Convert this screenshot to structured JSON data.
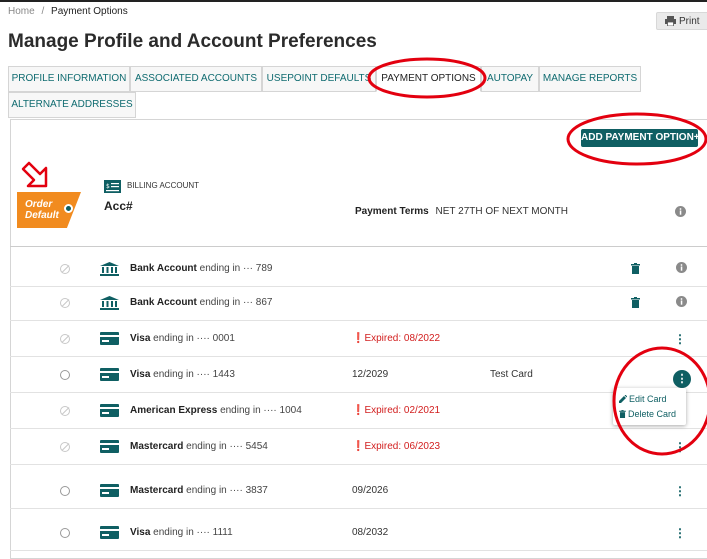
{
  "breadcrumb": {
    "home": "Home",
    "separator": "/",
    "current": "Payment Options"
  },
  "print_label": "Print",
  "title": "Manage Profile and Account Preferences",
  "tabs": [
    {
      "label": "PROFILE INFORMATION"
    },
    {
      "label": "ASSOCIATED ACCOUNTS"
    },
    {
      "label": "USEPOINT DEFAULTS"
    },
    {
      "label": "PAYMENT OPTIONS",
      "active": true
    },
    {
      "label": "AUTOPAY"
    },
    {
      "label": "MANAGE REPORTS"
    },
    {
      "label": "ALTERNATE ADDRESSES"
    }
  ],
  "add_button": "ADD PAYMENT OPTION+",
  "order_default": {
    "line1": "Order",
    "line2": "Default"
  },
  "billing": {
    "label": "BILLING ACCOUNT",
    "account_no": "Acc#",
    "terms_label": "Payment Terms",
    "terms_value": "NET 27TH OF NEXT MONTH"
  },
  "payment_methods": [
    {
      "name": "Bank Account",
      "ending": "ending in ··· 789",
      "icon": "bank-icon",
      "selectable": false,
      "expiry": "",
      "expired": false,
      "note": "",
      "action": "delete-info"
    },
    {
      "name": "Bank Account",
      "ending": "ending in ··· 867",
      "icon": "bank-icon",
      "selectable": false,
      "expiry": "",
      "expired": false,
      "note": "",
      "action": "delete-info"
    },
    {
      "name": "Visa",
      "ending": "ending in ···· 0001",
      "icon": "card-icon",
      "selectable": false,
      "expiry": "Expired: 08/2022",
      "expired": true,
      "note": "",
      "action": "menu"
    },
    {
      "name": "Visa",
      "ending": "ending in ···· 1443",
      "icon": "card-icon",
      "selectable": true,
      "expiry": "12/2029",
      "expired": false,
      "note": "Test Card",
      "action": "menu-open"
    },
    {
      "name": "American Express",
      "ending": "ending in ···· 1004",
      "icon": "card-icon",
      "selectable": false,
      "expiry": "Expired: 02/2021",
      "expired": true,
      "note": "",
      "action": "menu"
    },
    {
      "name": "Mastercard",
      "ending": "ending in ···· 5454",
      "icon": "card-icon",
      "selectable": false,
      "expiry": "Expired: 06/2023",
      "expired": true,
      "note": "",
      "action": "menu"
    },
    {
      "name": "Mastercard",
      "ending": "ending in ···· 3837",
      "icon": "card-icon",
      "selectable": true,
      "expiry": "09/2026",
      "expired": false,
      "note": "",
      "action": "menu"
    },
    {
      "name": "Visa",
      "ending": "ending in ···· 1111",
      "icon": "card-icon",
      "selectable": true,
      "expiry": "08/2032",
      "expired": false,
      "note": "",
      "action": "menu"
    }
  ],
  "context_menu": {
    "edit": "Edit Card",
    "delete": "Delete Card"
  },
  "colors": {
    "accent": "#0f5f63",
    "orange": "#f18b1f",
    "expired": "#d21e1e",
    "annotation": "#e3000f"
  }
}
